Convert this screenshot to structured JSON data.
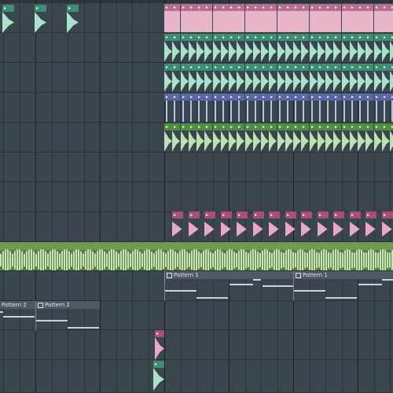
{
  "window": {
    "title": ""
  },
  "colors": {
    "background": "#3b454e",
    "lane_border": "#2a3138",
    "pink_clip": "#e8b4c8",
    "pink_head": "#b76e8f",
    "teal_clip": "#a9e3cc",
    "teal_head": "#3d8f72",
    "blue_clip": "#b8c2e8",
    "blue_head": "#5a68a8",
    "green_clip": "#bfe0b0",
    "green_head": "#4f8f43",
    "kick_clip": "#e8a9c4",
    "kick_head": "#a84f72",
    "audio_wave": "#c8e6b4",
    "pattern_note": "#c9d2da"
  },
  "icons": {
    "clip_play": "play-icon",
    "pattern": "pattern-icon"
  },
  "patterns": {
    "pattern1_label": "Pattern 1",
    "pattern2_label": "Pattern 2"
  }
}
